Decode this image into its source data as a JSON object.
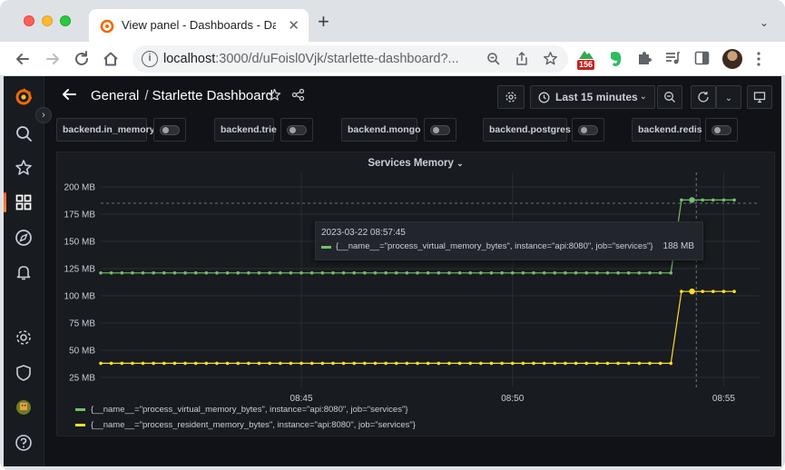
{
  "browser": {
    "tab_title": "View panel - Dashboards - Das",
    "url_host": "localhost",
    "url_path": ":3000/d/uFoisl0Vjk/starlette-dashboard?...",
    "extension_badge": "156"
  },
  "dashboard": {
    "folder": "General",
    "separator": "/",
    "title": "Starlette Dashboard",
    "time_range": "Last 15 minutes"
  },
  "variables": [
    {
      "label": "backend.in_memory",
      "enabled": false
    },
    {
      "label": "backend.trie",
      "enabled": false
    },
    {
      "label": "backend.mongo",
      "enabled": false
    },
    {
      "label": "backend.postgres",
      "enabled": false
    },
    {
      "label": "backend.redis",
      "enabled": false
    }
  ],
  "panel": {
    "title": "Services Memory",
    "tooltip": {
      "time": "2023-03-22 08:57:45",
      "series": "{__name__=\"process_virtual_memory_bytes\", instance=\"api:8080\", job=\"services\"}",
      "value": "188 MB"
    },
    "legend": [
      {
        "label": "{__name__=\"process_virtual_memory_bytes\", instance=\"api:8080\", job=\"services\"}",
        "color": "#73bf69"
      },
      {
        "label": "{__name__=\"process_resident_memory_bytes\", instance=\"api:8080\", job=\"services\"}",
        "color": "#fade2a"
      }
    ]
  },
  "chart_data": {
    "type": "line",
    "y_unit": "MB",
    "ylim": [
      25,
      200
    ],
    "yticks": [
      "200 MB",
      "175 MB",
      "150 MB",
      "125 MB",
      "100 MB",
      "75 MB",
      "50 MB",
      "25 MB"
    ],
    "ytick_values": [
      200,
      175,
      150,
      125,
      100,
      75,
      50,
      25
    ],
    "xticks": [
      "08:45",
      "08:50",
      "08:55"
    ],
    "xtick_minutes": [
      4.75,
      9.75,
      14.75
    ],
    "xlim_minutes": [
      0,
      15.6
    ],
    "grid": true,
    "legend_position": "bottom",
    "crosshair_minute": 14.1,
    "crosshair_value": 185,
    "series": [
      {
        "name": "{__name__=\"process_virtual_memory_bytes\", instance=\"api:8080\", job=\"services\"}",
        "color": "#73bf69",
        "points": [
          [
            0,
            121
          ],
          [
            0.25,
            121
          ],
          [
            0.5,
            121
          ],
          [
            0.75,
            121
          ],
          [
            1,
            121
          ],
          [
            1.25,
            121
          ],
          [
            1.5,
            121
          ],
          [
            1.75,
            121
          ],
          [
            2,
            121
          ],
          [
            2.25,
            121
          ],
          [
            2.5,
            121
          ],
          [
            2.75,
            121
          ],
          [
            3,
            121
          ],
          [
            3.25,
            121
          ],
          [
            3.5,
            121
          ],
          [
            3.75,
            121
          ],
          [
            4,
            121
          ],
          [
            4.25,
            121
          ],
          [
            4.5,
            121
          ],
          [
            4.75,
            121
          ],
          [
            5,
            121
          ],
          [
            5.25,
            121
          ],
          [
            5.5,
            121
          ],
          [
            5.75,
            121
          ],
          [
            6,
            121
          ],
          [
            6.25,
            121
          ],
          [
            6.5,
            121
          ],
          [
            6.75,
            121
          ],
          [
            7,
            121
          ],
          [
            7.25,
            121
          ],
          [
            7.5,
            121
          ],
          [
            7.75,
            121
          ],
          [
            8,
            121
          ],
          [
            8.25,
            121
          ],
          [
            8.5,
            121
          ],
          [
            8.75,
            121
          ],
          [
            9,
            121
          ],
          [
            9.25,
            121
          ],
          [
            9.5,
            121
          ],
          [
            9.75,
            121
          ],
          [
            10,
            121
          ],
          [
            10.25,
            121
          ],
          [
            10.5,
            121
          ],
          [
            10.75,
            121
          ],
          [
            11,
            121
          ],
          [
            11.25,
            121
          ],
          [
            11.5,
            121
          ],
          [
            11.75,
            121
          ],
          [
            12,
            121
          ],
          [
            12.25,
            121
          ],
          [
            12.5,
            121
          ],
          [
            12.75,
            121
          ],
          [
            13,
            121
          ],
          [
            13.25,
            121
          ],
          [
            13.5,
            121
          ],
          [
            13.75,
            188
          ],
          [
            14,
            188
          ],
          [
            14.25,
            188
          ],
          [
            14.5,
            188
          ],
          [
            14.75,
            188
          ],
          [
            15,
            188
          ]
        ]
      },
      {
        "name": "{__name__=\"process_resident_memory_bytes\", instance=\"api:8080\", job=\"services\"}",
        "color": "#fade2a",
        "points": [
          [
            0,
            38
          ],
          [
            0.25,
            38
          ],
          [
            0.5,
            38
          ],
          [
            0.75,
            38
          ],
          [
            1,
            38
          ],
          [
            1.25,
            38
          ],
          [
            1.5,
            38
          ],
          [
            1.75,
            38
          ],
          [
            2,
            38
          ],
          [
            2.25,
            38
          ],
          [
            2.5,
            38
          ],
          [
            2.75,
            38
          ],
          [
            3,
            38
          ],
          [
            3.25,
            38
          ],
          [
            3.5,
            38
          ],
          [
            3.75,
            38
          ],
          [
            4,
            38
          ],
          [
            4.25,
            38
          ],
          [
            4.5,
            38
          ],
          [
            4.75,
            38
          ],
          [
            5,
            38
          ],
          [
            5.25,
            38
          ],
          [
            5.5,
            38
          ],
          [
            5.75,
            38
          ],
          [
            6,
            38
          ],
          [
            6.25,
            38
          ],
          [
            6.5,
            38
          ],
          [
            6.75,
            38
          ],
          [
            7,
            38
          ],
          [
            7.25,
            38
          ],
          [
            7.5,
            38
          ],
          [
            7.75,
            38
          ],
          [
            8,
            38
          ],
          [
            8.25,
            38
          ],
          [
            8.5,
            38
          ],
          [
            8.75,
            38
          ],
          [
            9,
            38
          ],
          [
            9.25,
            38
          ],
          [
            9.5,
            38
          ],
          [
            9.75,
            38
          ],
          [
            10,
            38
          ],
          [
            10.25,
            38
          ],
          [
            10.5,
            38
          ],
          [
            10.75,
            38
          ],
          [
            11,
            38
          ],
          [
            11.25,
            38
          ],
          [
            11.5,
            38
          ],
          [
            11.75,
            38
          ],
          [
            12,
            38
          ],
          [
            12.25,
            38
          ],
          [
            12.5,
            38
          ],
          [
            12.75,
            38
          ],
          [
            13,
            38
          ],
          [
            13.25,
            38
          ],
          [
            13.5,
            38
          ],
          [
            13.75,
            104
          ],
          [
            14,
            104
          ],
          [
            14.25,
            104
          ],
          [
            14.5,
            104
          ],
          [
            14.75,
            104
          ],
          [
            15,
            104
          ]
        ]
      }
    ]
  }
}
